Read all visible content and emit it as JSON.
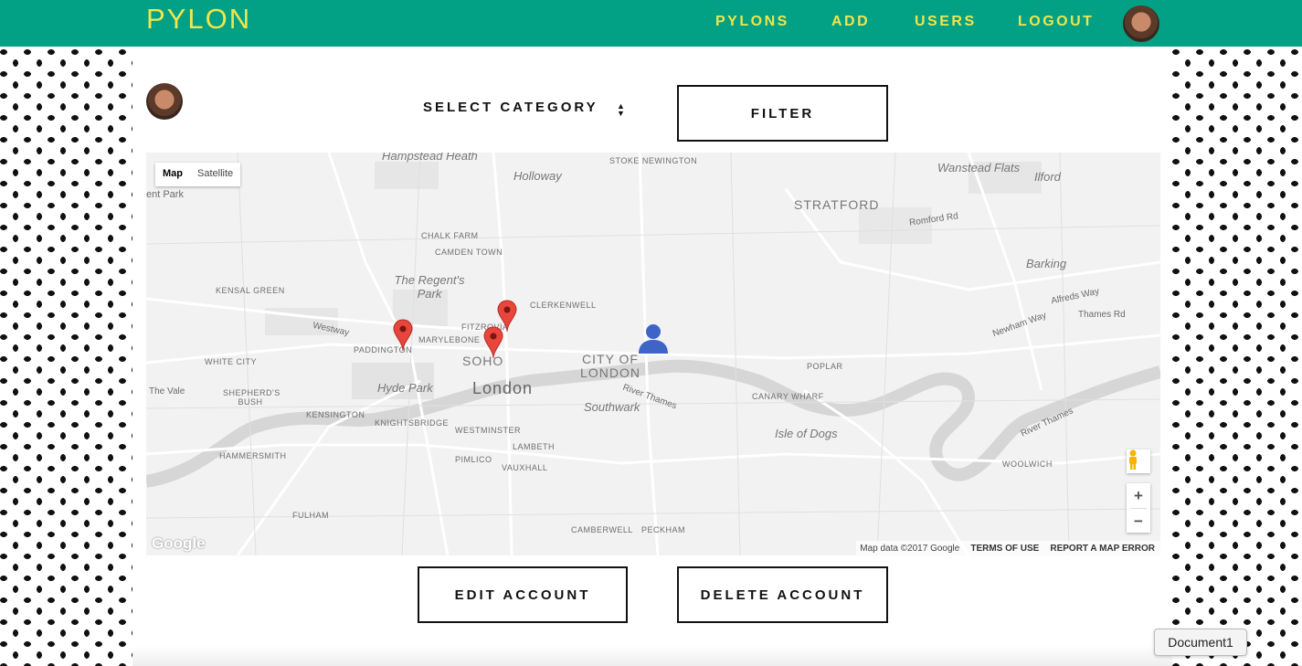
{
  "app": {
    "brand": "PYLON"
  },
  "nav": {
    "links": [
      "PYLONS",
      "ADD",
      "USERS",
      "LOGOUT"
    ]
  },
  "filter_bar": {
    "select_label": "SELECT CATEGORY",
    "filter_button": "FILTER"
  },
  "map": {
    "type_controls": {
      "map": "Map",
      "satellite": "Satellite"
    },
    "zoom": {
      "in": "+",
      "out": "−"
    },
    "logo": "Google",
    "attribution": {
      "data": "Map data ©2017 Google",
      "terms": "TERMS OF USE",
      "report": "REPORT A MAP ERROR"
    },
    "labels": {
      "hampstead_heath": "Hampstead Heath",
      "stoke_newington": "STOKE NEWINGTON",
      "holloway": "Holloway",
      "wanstead_flats": "Wanstead Flats",
      "ilford": "Ilford",
      "stratford": "STRATFORD",
      "kent_park": "ent Park",
      "chalk_farm": "CHALK FARM",
      "camden_town": "CAMDEN TOWN",
      "barking": "Barking",
      "regents_park": "The Regent's Park",
      "kensal_green": "KENSAL GREEN",
      "clerkenwell": "CLERKENWELL",
      "fitzrovia": "FITZROVIA",
      "marylebone": "MARYLEBONE",
      "paddington": "PADDINGTON",
      "soho": "SOHO",
      "city_of_london": "CITY OF LONDON",
      "white_city": "WHITE CITY",
      "poplar": "POPLAR",
      "hyde_park": "Hyde Park",
      "london": "London",
      "the_vale": "The Vale",
      "shepherds_bush": "SHEPHERD'S BUSH",
      "southwark": "Southwark",
      "canary_wharf": "CANARY WHARF",
      "kensington": "KENSINGTON",
      "knightsbridge": "KNIGHTSBRIDGE",
      "westminster": "WESTMINSTER",
      "isle_of_dogs": "Isle of Dogs",
      "lambeth": "LAMBETH",
      "hammersmith": "HAMMERSMITH",
      "pimlico": "PIMLICO",
      "vauxhall": "VAUXHALL",
      "woolwich": "WOOLWICH",
      "fulham": "FULHAM",
      "camberwell": "CAMBERWELL",
      "peckham": "PECKHAM",
      "river_thames": "River Thames",
      "thames_road": "Thames Rd",
      "newham_way": "Newham Way",
      "alfreds_way": "Alfreds Way",
      "westway": "Westway",
      "romford_rd": "Romford Rd"
    },
    "markers": [
      {
        "type": "pylon",
        "color": "#e8453c"
      },
      {
        "type": "pylon",
        "color": "#e8453c"
      },
      {
        "type": "pylon",
        "color": "#e8453c"
      },
      {
        "type": "user",
        "color": "#3e64c8"
      }
    ]
  },
  "account": {
    "edit_button": "EDIT ACCOUNT",
    "delete_button": "DELETE ACCOUNT"
  },
  "tooltip": {
    "text": "Document1"
  },
  "colors": {
    "navbar": "#02a085",
    "brand": "#f0e64c",
    "marker": "#e8453c",
    "user_marker": "#3e64c8"
  }
}
